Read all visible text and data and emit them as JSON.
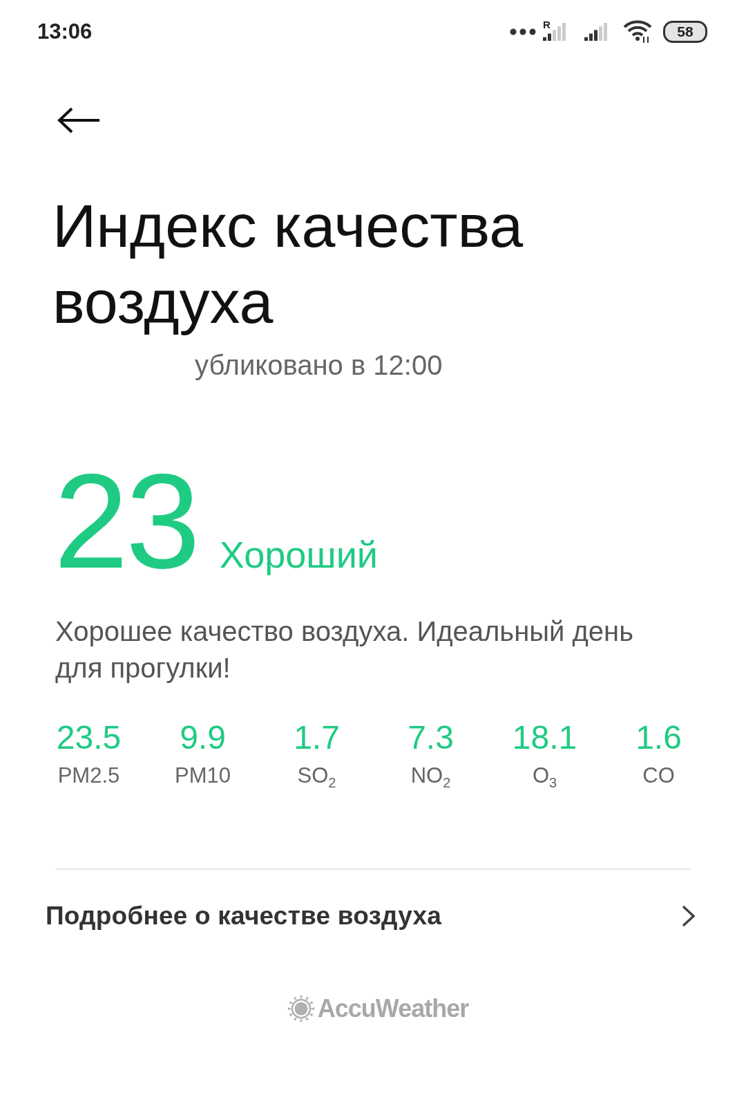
{
  "status_bar": {
    "time": "13:06",
    "roaming": "R",
    "battery": "58"
  },
  "title": "Индекс качества воздуха",
  "subtitle": "убликовано в 12:00",
  "aqi": {
    "value": "23",
    "category": "Хороший",
    "description": "Хорошее качество воздуха. Идеальный день для прогулки!"
  },
  "pollutants": [
    {
      "value": "23.5",
      "name": "PM2.5"
    },
    {
      "value": "9.9",
      "name": "PM10"
    },
    {
      "value": "1.7",
      "name": "SO$_{2}$"
    },
    {
      "value": "7.3",
      "name": "NO$_{2}$"
    },
    {
      "value": "18.1",
      "name": "O$_{3}$"
    },
    {
      "value": "1.6",
      "name": "CO"
    }
  ],
  "more_link": "Подробнее о качестве воздуха",
  "footer": {
    "brand": "AccuWeather"
  }
}
